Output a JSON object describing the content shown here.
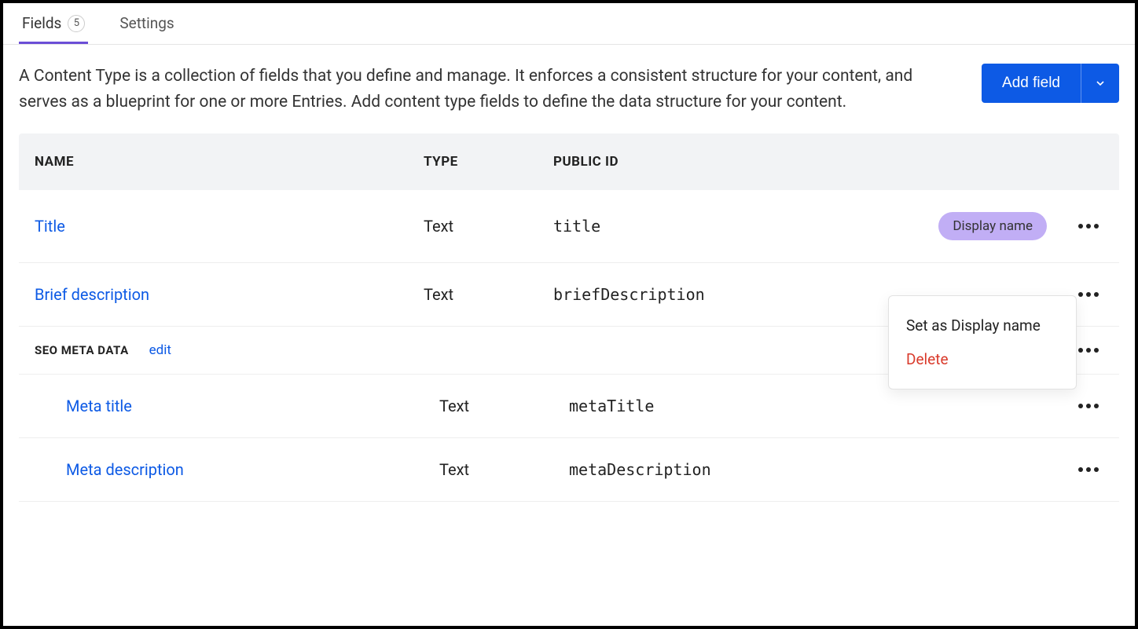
{
  "tabs": {
    "fields_label": "Fields",
    "fields_count": "5",
    "settings_label": "Settings"
  },
  "description": "A Content Type is a collection of fields that you define and manage. It enforces a consistent structure for your content, and serves as a blueprint for one or more Entries. Add content type fields to define the data structure for your content.",
  "buttons": {
    "add_field": "Add field"
  },
  "table_headers": {
    "name": "NAME",
    "type": "TYPE",
    "public_id": "PUBLIC ID"
  },
  "rows": [
    {
      "name": "Title",
      "type": "Text",
      "public_id": "title",
      "badge": "Display name"
    },
    {
      "name": "Brief description",
      "type": "Text",
      "public_id": "briefDescription"
    }
  ],
  "group": {
    "label": "SEO META DATA",
    "edit": "edit"
  },
  "sub_rows": [
    {
      "name": "Meta title",
      "type": "Text",
      "public_id": "metaTitle"
    },
    {
      "name": "Meta description",
      "type": "Text",
      "public_id": "metaDescription"
    }
  ],
  "context_menu": {
    "set_display": "Set as Display name",
    "delete": "Delete"
  }
}
